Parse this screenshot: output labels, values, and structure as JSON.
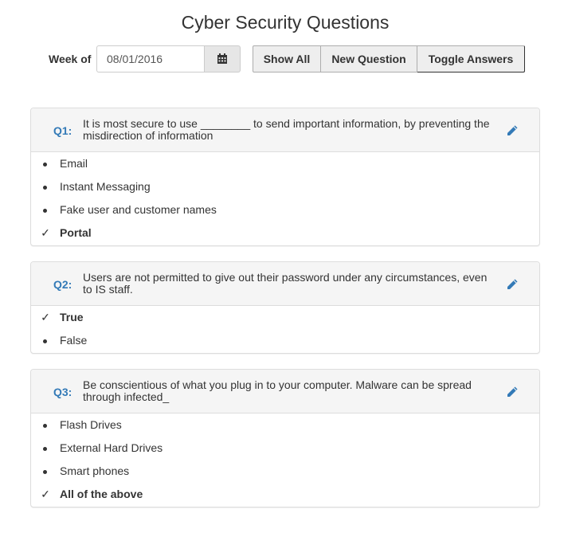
{
  "page": {
    "title": "Cyber Security Questions"
  },
  "toolbar": {
    "week_label": "Week of",
    "date_value": "08/01/2016",
    "calendar_icon": "calendar-icon",
    "buttons": [
      "Show All",
      "New Question",
      "Toggle Answers"
    ]
  },
  "colors": {
    "question_number": "#337ab7",
    "heading_bg": "#f5f5f5"
  },
  "questions": [
    {
      "number": "Q1:",
      "text": "It is most secure to use ________ to send important information, by preventing the misdirection of information",
      "answers": [
        {
          "text": "Email",
          "correct": false
        },
        {
          "text": "Instant Messaging",
          "correct": false
        },
        {
          "text": "Fake user and customer names",
          "correct": false
        },
        {
          "text": "Portal",
          "correct": true
        }
      ]
    },
    {
      "number": "Q2:",
      "text": "Users are not permitted to give out their password under any circumstances, even to IS staff.",
      "answers": [
        {
          "text": "True",
          "correct": true
        },
        {
          "text": "False",
          "correct": false
        }
      ]
    },
    {
      "number": "Q3:",
      "text": "Be conscientious of what you plug in to your computer. Malware can be spread through infected_",
      "answers": [
        {
          "text": "Flash Drives",
          "correct": false
        },
        {
          "text": "External Hard Drives",
          "correct": false
        },
        {
          "text": "Smart phones",
          "correct": false
        },
        {
          "text": "All of the above",
          "correct": true
        }
      ]
    }
  ]
}
